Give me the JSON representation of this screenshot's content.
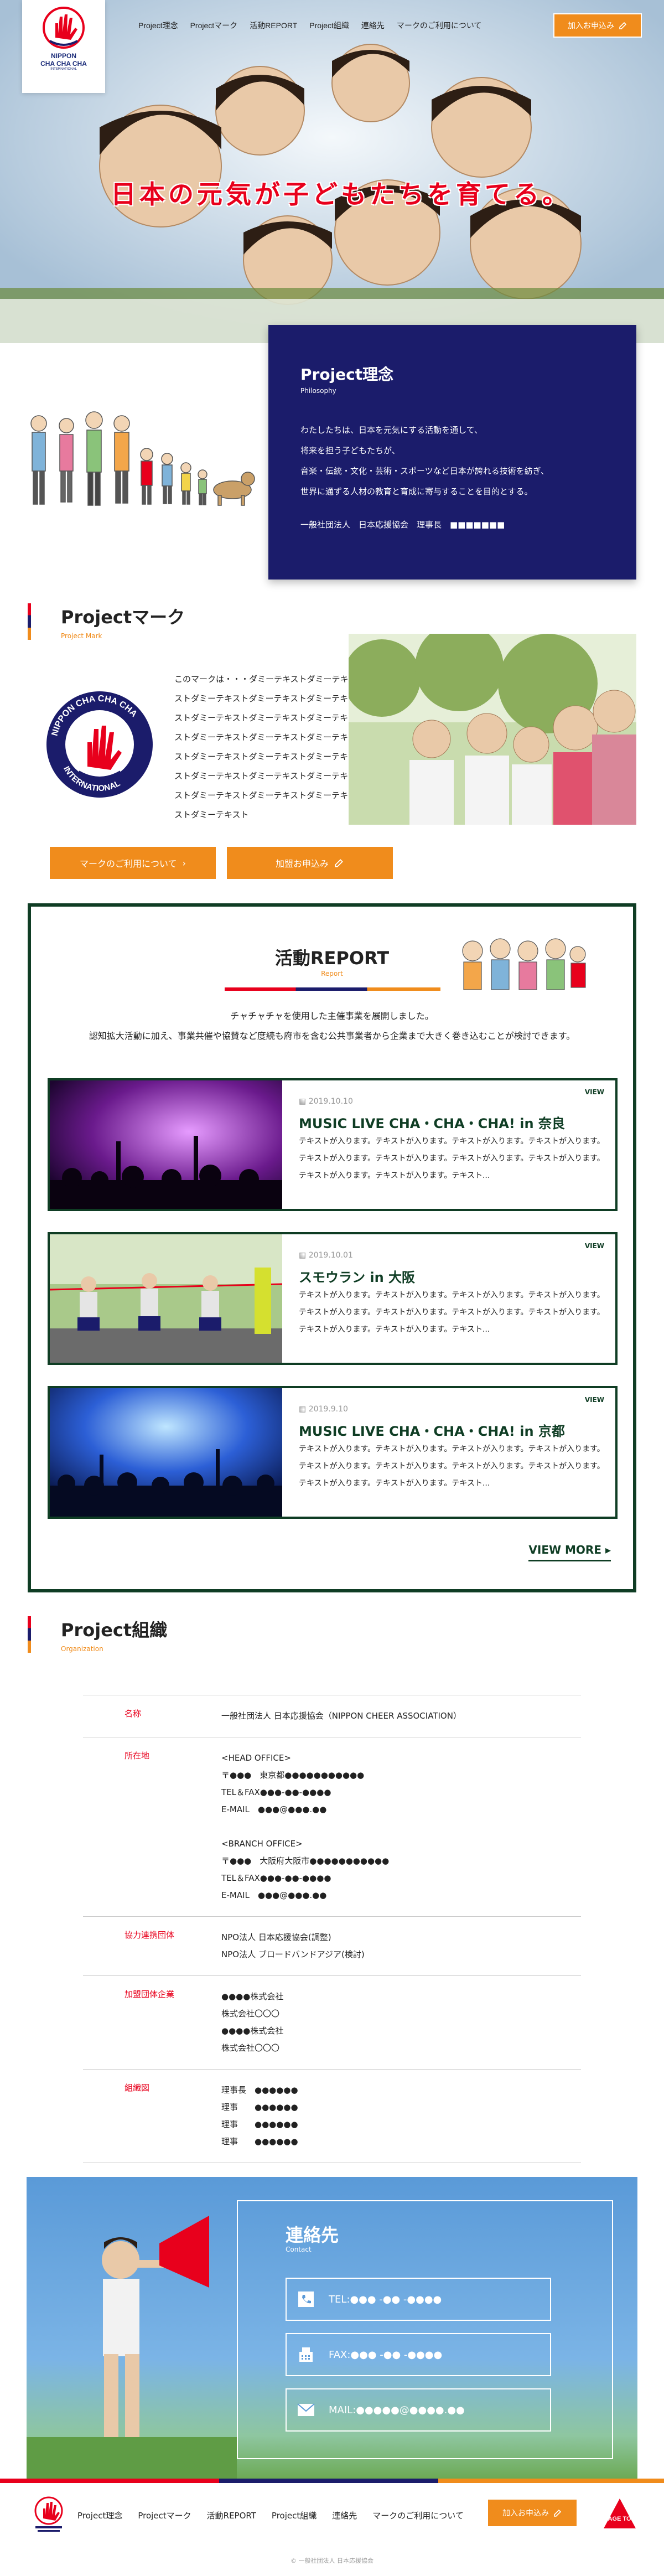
{
  "header": {
    "logo_lines": [
      "NIPPON",
      "CHA CHA CHA"
    ],
    "logo_sub": "INTERNATIONAL",
    "nav": [
      "Project理念",
      "Projectマーク",
      "活動REPORT",
      "Project組織",
      "連絡先",
      "マークのご利用について"
    ],
    "apply_button": "加入お申込み"
  },
  "hero": {
    "catch": "日本の元気が子どもたちを育てる。"
  },
  "philosophy": {
    "title": "Project理念",
    "subtitle": "Philosophy",
    "lines": [
      "わたしたちは、日本を元気にする活動を通して、",
      "将来を担う子どもたちが、",
      "音楽・伝統・文化・芸術・スポーツなど日本が誇れる技術を紡ぎ、",
      "世界に通ずる人材の教育と育成に寄与することを目的とする。"
    ],
    "signature": "一般社団法人　日本応援協会　理事長　■■■■■■■"
  },
  "mark": {
    "title": "Projectマーク",
    "subtitle": "Project Mark",
    "text_lines": [
      "このマークは・・・ダミーテキストダミーテキ",
      "ストダミーテキストダミーテキストダミーテキ",
      "ストダミーテキストダミーテキストダミーテキ",
      "ストダミーテキストダミーテキストダミーテキ",
      "ストダミーテキストダミーテキストダミーテキ",
      "ストダミーテキストダミーテキストダミーテキ",
      "ストダミーテキストダミーテキストダミーテキ",
      "ストダミーテキスト"
    ],
    "button_usage": "マークのご利用について",
    "button_apply": "加盟お申込み",
    "emblem_text": "NIPPON CHA CHA CHA INTERNATIONAL"
  },
  "report": {
    "title": "活動REPORT",
    "subtitle": "Report",
    "lead_lines": [
      "チャチャチャを使用した主催事業を展開しました。",
      "認知拡大活動に加え、事業共催や協賛など度続も府市を含む公共事業者から企業まで大きく巻き込むことが検討できます。"
    ],
    "view_label": "VIEW",
    "cards": [
      {
        "date": "2019.10.10",
        "title": "MUSIC LIVE CHA・CHA・CHA! in 奈良",
        "text": "テキストが入ります。テキストが入ります。テキストが入ります。テキストが入ります。テキストが入ります。テキストが入ります。テキストが入ります。テキストが入ります。テキストが入ります。テキストが入ります。テキスト..."
      },
      {
        "date": "2019.10.01",
        "title": "スモウラン in 大阪",
        "text": "テキストが入ります。テキストが入ります。テキストが入ります。テキストが入ります。テキストが入ります。テキストが入ります。テキストが入ります。テキストが入ります。テキストが入ります。テキストが入ります。テキスト..."
      },
      {
        "date": "2019.9.10",
        "title": "MUSIC LIVE CHA・CHA・CHA! in 京都",
        "text": "テキストが入ります。テキストが入ります。テキストが入ります。テキストが入ります。テキストが入ります。テキストが入ります。テキストが入ります。テキストが入ります。テキストが入ります。テキストが入ります。テキスト..."
      }
    ],
    "view_more": "VIEW MORE ▸"
  },
  "org": {
    "title": "Project組織",
    "subtitle": "Organization",
    "rows": [
      {
        "label": "名称",
        "lines": [
          "一般社団法人 日本応援協会（NIPPON CHEER ASSOCIATION）"
        ]
      },
      {
        "label": "所在地",
        "lines": [
          "<HEAD OFFICE>",
          "〒●●●　東京都●●●●●●●●●●●",
          "TEL＆FAX●●●-●●-●●●●",
          "E-MAIL　●●●@●●●.●●",
          "",
          "<BRANCH OFFICE>",
          "〒●●●　大阪府大阪市●●●●●●●●●●●",
          "TEL＆FAX●●●-●●-●●●●",
          "E-MAIL　●●●@●●●.●●"
        ]
      },
      {
        "label": "協力連携団体",
        "lines": [
          "NPO法人 日本応援協会(調整)",
          "NPO法人 ブロードバンドアジア(検討)"
        ]
      },
      {
        "label": "加盟団体企業",
        "lines": [
          "●●●●株式会社",
          "株式会社〇〇〇",
          "●●●●株式会社",
          "株式会社〇〇〇"
        ]
      },
      {
        "label": "組織図",
        "lines": [
          "理事長　●●●●●●",
          "理事　　●●●●●●",
          "理事　　●●●●●●",
          "理事　　●●●●●●"
        ]
      }
    ]
  },
  "contact": {
    "title": "連絡先",
    "subtitle": "Contact",
    "tel": "TEL:●●● -●● -●●●●",
    "fax": "FAX:●●● -●● -●●●●",
    "mail": "MAIL:●●●●●@●●●●.●●"
  },
  "footer": {
    "nav": [
      "Project理念",
      "Projectマーク",
      "活動REPORT",
      "Project組織",
      "連絡先",
      "マークのご利用について"
    ],
    "apply_button": "加入お申込み",
    "pagetop": "PAGE TOP",
    "copyright": "© 一般社団法人 日本応援協会"
  },
  "colors": {
    "red": "#e8001c",
    "navy": "#1b1c6b",
    "orange": "#f08c1c",
    "green": "#0f3d24"
  }
}
